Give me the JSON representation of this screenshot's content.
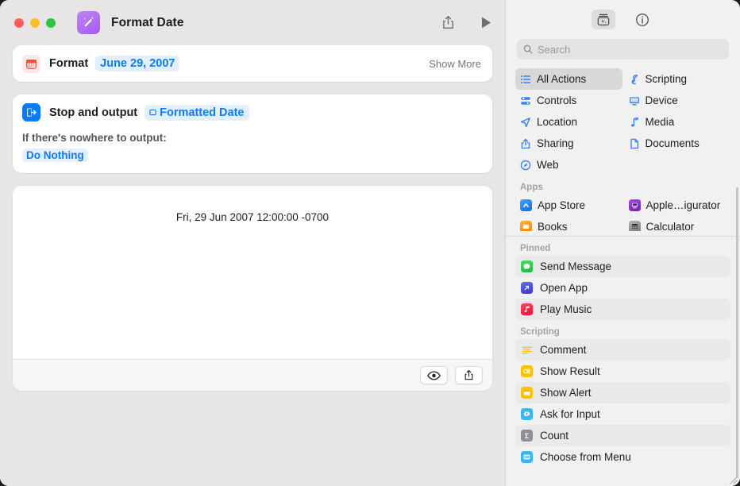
{
  "window": {
    "title": "Format Date",
    "app_icon": "magic-wand-icon",
    "traffic_lights": [
      "close",
      "minimize",
      "zoom"
    ],
    "toolbar": {
      "share_label": "share-icon",
      "run_label": "play-icon"
    }
  },
  "editor": {
    "actions": [
      {
        "icon": "calendar-icon",
        "label": "Format",
        "token": "June 29, 2007",
        "trailing": "Show More"
      },
      {
        "icon": "stop-output-icon",
        "label": "Stop and output",
        "token": "Formatted Date",
        "token_glyph": "variable-icon",
        "sub_label": "If there's nowhere to output:",
        "link": "Do Nothing"
      }
    ],
    "preview": {
      "result_text": "Fri, 29 Jun 2007 12:00:00 -0700",
      "buttons": [
        {
          "name": "quick-look-button",
          "icon": "eye-icon"
        },
        {
          "name": "share-result-button",
          "icon": "share-icon"
        }
      ]
    }
  },
  "sidebar": {
    "toolbar": [
      {
        "name": "action-library-button",
        "icon": "library-icon",
        "active": true
      },
      {
        "name": "info-button",
        "icon": "info-icon",
        "active": false
      }
    ],
    "search": {
      "placeholder": "Search",
      "value": "",
      "icon": "search-icon"
    },
    "categories": [
      {
        "label": "All Actions",
        "icon": "list-icon",
        "color": "#3b82f6",
        "selected": true
      },
      {
        "label": "Scripting",
        "icon": "scripting-icon",
        "color": "#3b82f6",
        "selected": false
      },
      {
        "label": "Controls",
        "icon": "controls-icon",
        "color": "#3b82f6",
        "selected": false
      },
      {
        "label": "Device",
        "icon": "display-icon",
        "color": "#3b82f6",
        "selected": false
      },
      {
        "label": "Location",
        "icon": "location-arrow-icon",
        "color": "#3b82f6",
        "selected": false
      },
      {
        "label": "Media",
        "icon": "music-note-icon",
        "color": "#3b82f6",
        "selected": false
      },
      {
        "label": "Sharing",
        "icon": "share-icon",
        "color": "#3b82f6",
        "selected": false
      },
      {
        "label": "Documents",
        "icon": "document-icon",
        "color": "#3b82f6",
        "selected": false
      },
      {
        "label": "Web",
        "icon": "compass-icon",
        "color": "#3b82f6",
        "selected": false
      }
    ],
    "apps_section": {
      "title": "Apps",
      "items": [
        {
          "label": "App Store",
          "icon": "app-store-icon",
          "color": "#1f8cf5"
        },
        {
          "label": "Apple…igurator",
          "icon": "apple-configurator-icon",
          "color": "#8b3ed6"
        },
        {
          "label": "Books",
          "icon": "books-icon",
          "color": "#ff9f0a"
        },
        {
          "label": "Calculator",
          "icon": "calculator-icon",
          "color": "#8e8e93"
        }
      ]
    },
    "pinned_section": {
      "title": "Pinned",
      "items": [
        {
          "label": "Send Message",
          "icon": "messages-icon",
          "color": "#31c65b"
        },
        {
          "label": "Open App",
          "icon": "open-app-icon",
          "color": "#4c51d6"
        },
        {
          "label": "Play Music",
          "icon": "music-icon",
          "color": "#fa2d48"
        }
      ]
    },
    "scripting_section": {
      "title": "Scripting",
      "items": [
        {
          "label": "Comment",
          "icon": "comment-icon",
          "color": "#ffc107"
        },
        {
          "label": "Show Result",
          "icon": "show-result-icon",
          "color": "#ffc107"
        },
        {
          "label": "Show Alert",
          "icon": "show-alert-icon",
          "color": "#ffc107"
        },
        {
          "label": "Ask for Input",
          "icon": "ask-input-icon",
          "color": "#3ab6f5"
        },
        {
          "label": "Count",
          "icon": "sigma-icon",
          "color": "#8e8e93"
        },
        {
          "label": "Choose from Menu",
          "icon": "menu-icon",
          "color": "#3ab6f5"
        }
      ]
    }
  },
  "colors": {
    "window_bg": "#e8e5e5",
    "sidebar_bg": "#f2f1f2",
    "card_bg": "#ffffff",
    "accent_blue": "#0a7cf8",
    "token_bg": "#e3effd",
    "selection_gray": "#d9d7d8"
  }
}
